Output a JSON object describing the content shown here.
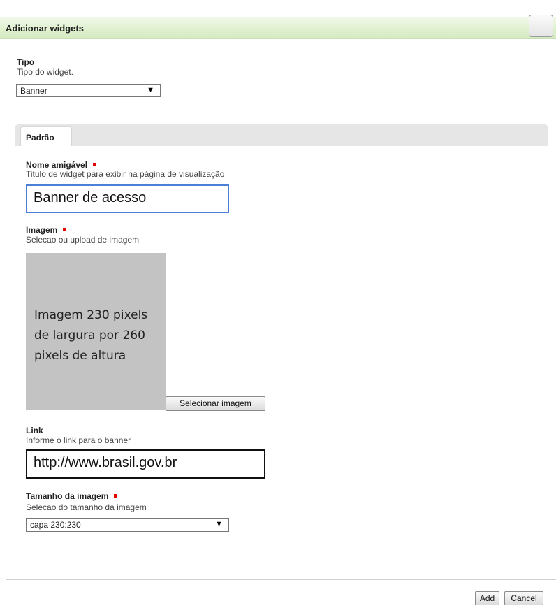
{
  "dialog": {
    "title": "Adicionar widgets"
  },
  "tipo": {
    "label": "Tipo",
    "description": "Tipo do widget.",
    "selected": "Banner"
  },
  "tabs": [
    {
      "label": "Padrão",
      "active": true
    }
  ],
  "nome": {
    "label": "Nome amigável",
    "description": "Titulo de widget para exibir na página de visualização",
    "value": "Banner de acesso",
    "required": true
  },
  "imagem": {
    "label": "Imagem",
    "description": "Selecao ou upload de imagem",
    "placeholder_text": "Imagem 230 pixels de largura por 260 pixels de altura",
    "select_button": "Selecionar imagem",
    "required": true
  },
  "link": {
    "label": "Link",
    "description": "Informe o link para o banner",
    "value": "http://www.brasil.gov.br"
  },
  "tamanho": {
    "label": "Tamanho da imagem",
    "description": "Selecao do tamanho da imagem",
    "selected": "capa 230:230",
    "required": true
  },
  "footer": {
    "add_label": "Add",
    "cancel_label": "Cancel"
  },
  "colors": {
    "required_marker": "#e00000",
    "titlebar": "#dff0cf",
    "placeholder": "#c3c3c3"
  },
  "icons": {
    "dropdown": "triangle-down"
  }
}
